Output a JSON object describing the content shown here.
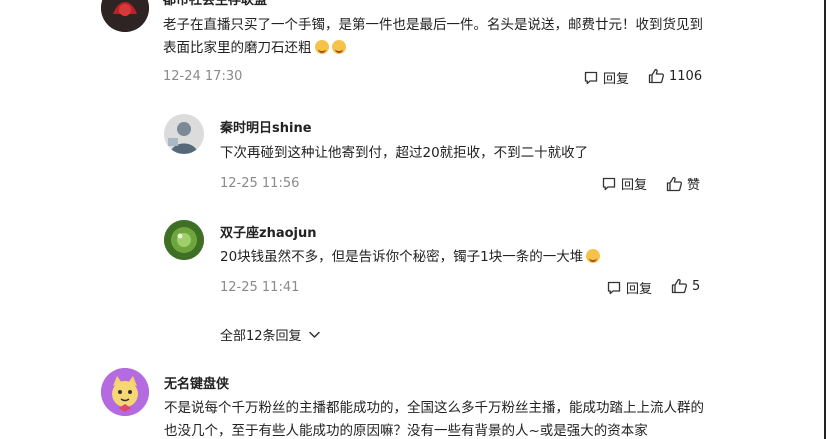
{
  "comments": [
    {
      "username": "都市社会生存联盟",
      "text": "老子在直播只买了一个手镯，是第一件也是最后一件。名头是说送，邮费廿元！收到货见到表面比家里的磨刀石还粗",
      "emojis": [
        "laugh-tears-emoji",
        "laugh-tears-emoji"
      ],
      "timestamp": "12-24 17:30",
      "reply_label": "回复",
      "like_count": "1106"
    },
    {
      "username": "秦时明日shine",
      "text": "下次再碰到这种让他寄到付，超过20就拒收，不到二十就收了",
      "timestamp": "12-25 11:56",
      "reply_label": "回复",
      "like_count": "赞"
    },
    {
      "username": "双子座zhaojun",
      "text": "20块钱虽然不多，但是告诉你个秘密，镯子1块一条的一大堆",
      "emojis": [
        "laugh-tears-emoji"
      ],
      "timestamp": "12-25 11:41",
      "reply_label": "回复",
      "like_count": "5"
    },
    {
      "username": "无名键盘侠",
      "text": "不是说每个千万粉丝的主播都能成功的，全国这么多千万粉丝主播，能成功踏上上流人群的也没几个，至于有些人能成功的原因嘛？没有一些有背景的人~或是强大的资本家"
    }
  ],
  "expand_replies": {
    "label": "全部12条回复"
  },
  "icons": {
    "reply": "comment-bubble-icon",
    "like": "thumbs-up-icon",
    "expand": "chevron-down-icon"
  },
  "colors": {
    "meta_gray": "#8a8a8a",
    "text": "#222222"
  }
}
